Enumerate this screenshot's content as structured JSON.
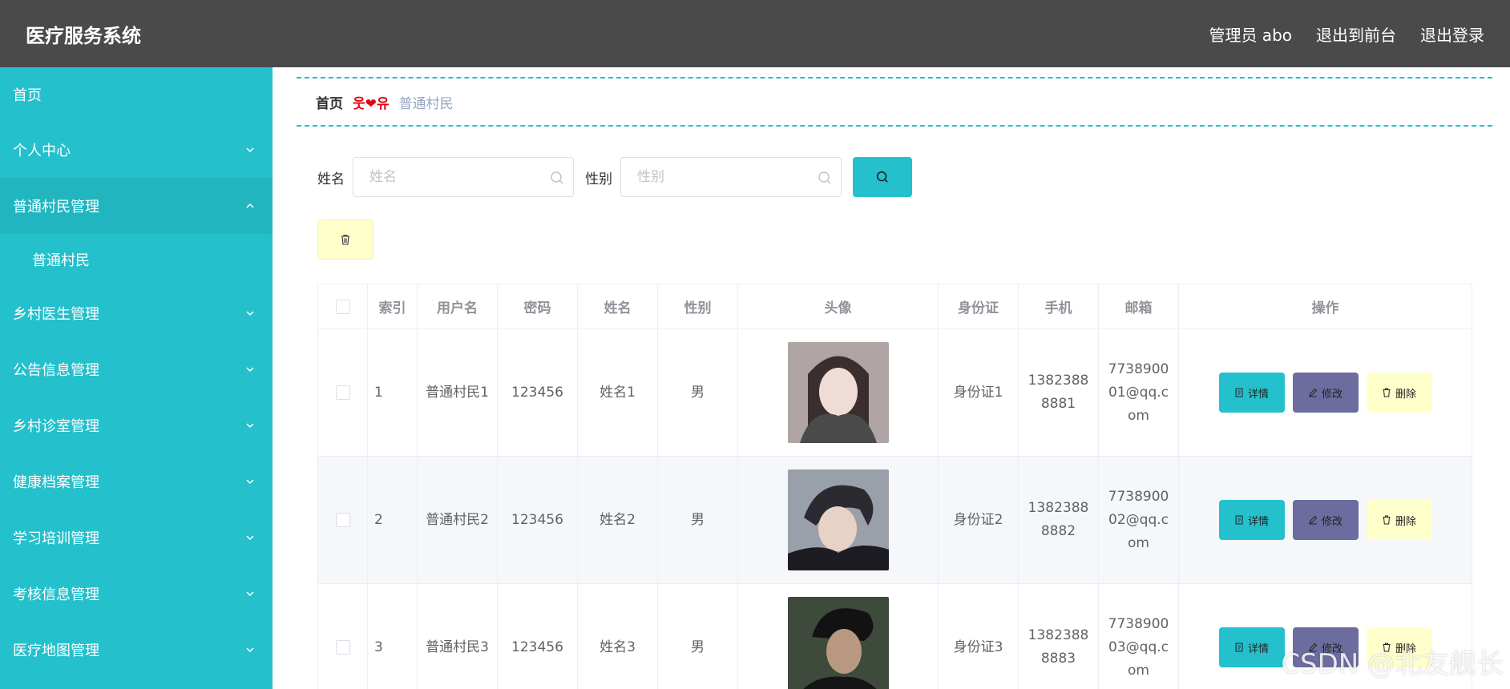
{
  "header": {
    "title": "医疗服务系统",
    "admin_label": "管理员 abo",
    "front_label": "退出到前台",
    "logout_label": "退出登录"
  },
  "sidebar": {
    "items": [
      {
        "label": "首页"
      },
      {
        "label": "个人中心"
      },
      {
        "label": "普通村民管理"
      },
      {
        "label": "普通村民"
      },
      {
        "label": "乡村医生管理"
      },
      {
        "label": "公告信息管理"
      },
      {
        "label": "乡村诊室管理"
      },
      {
        "label": "健康档案管理"
      },
      {
        "label": "学习培训管理"
      },
      {
        "label": "考核信息管理"
      },
      {
        "label": "医疗地图管理"
      }
    ]
  },
  "breadcrumb": {
    "home": "首页",
    "separator": "웃❤유",
    "current": "普通村民"
  },
  "search": {
    "name_label": "姓名",
    "name_placeholder": "姓名",
    "gender_label": "性别",
    "gender_placeholder": "性别"
  },
  "table": {
    "headers": [
      "索引",
      "用户名",
      "密码",
      "姓名",
      "性别",
      "头像",
      "身份证",
      "手机",
      "邮箱",
      "操作"
    ],
    "rows": [
      {
        "index": "1",
        "username": "普通村民1",
        "password": "123456",
        "name": "姓名1",
        "gender": "男",
        "idcard": "身份证1",
        "phone": "13823888881",
        "email": "773890001@qq.com"
      },
      {
        "index": "2",
        "username": "普通村民2",
        "password": "123456",
        "name": "姓名2",
        "gender": "男",
        "idcard": "身份证2",
        "phone": "13823888882",
        "email": "773890002@qq.com"
      },
      {
        "index": "3",
        "username": "普通村民3",
        "password": "123456",
        "name": "姓名3",
        "gender": "男",
        "idcard": "身份证3",
        "phone": "13823888883",
        "email": "773890003@qq.com"
      }
    ],
    "actions": {
      "detail": "详情",
      "edit": "修改",
      "delete": "删除"
    }
  },
  "watermark": "CSDN @北友舰长",
  "colors": {
    "accent": "#24c0cc",
    "header_bg": "#4a4a4a",
    "edit_btn": "#6d6c9f",
    "delete_btn": "#ffffcc"
  }
}
